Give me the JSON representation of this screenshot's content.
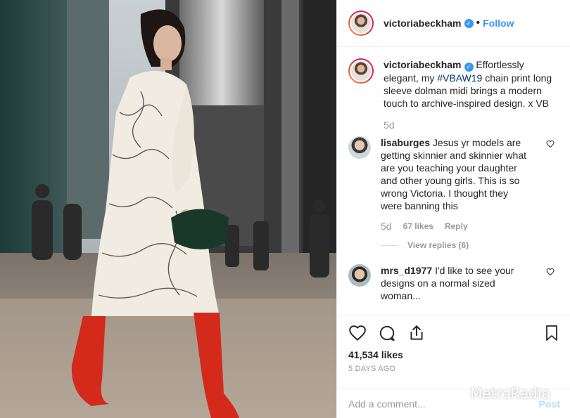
{
  "header": {
    "username": "victoriabeckham",
    "dot": "•",
    "follow_label": "Follow",
    "verified_glyph": "✓"
  },
  "caption": {
    "username": "victoriabeckham",
    "text_before": "Effortlessly elegant, my ",
    "hashtag": "#VBAW19",
    "text_after": " chain print long sleeve dolman midi brings a modern touch to archive-inspired design. x VB",
    "time": "5d"
  },
  "comments": [
    {
      "username": "lisaburges",
      "text": "Jesus yr models are getting skinnier and skinnier what are you teaching your daughter and other young girls. This is so wrong Victoria. I thought they were banning this",
      "time": "5d",
      "likes": "67 likes",
      "reply": "Reply",
      "view_replies": "View replies (6)"
    },
    {
      "username": "mrs_d1977",
      "text": "I'd like to see your designs on a normal sized woman..."
    }
  ],
  "stats": {
    "likes": "41,534 likes",
    "date": "5 DAYS AGO"
  },
  "composer": {
    "placeholder": "Add a comment...",
    "post_label": "Post"
  },
  "watermark": {
    "text": "MetroRadio"
  },
  "icons": {
    "like": "heart-icon",
    "comment": "comment-icon",
    "share": "share-icon",
    "save": "bookmark-icon"
  },
  "colors": {
    "accent": "#3897f0",
    "hashtag": "#003569",
    "boots": "#d42a1c"
  }
}
